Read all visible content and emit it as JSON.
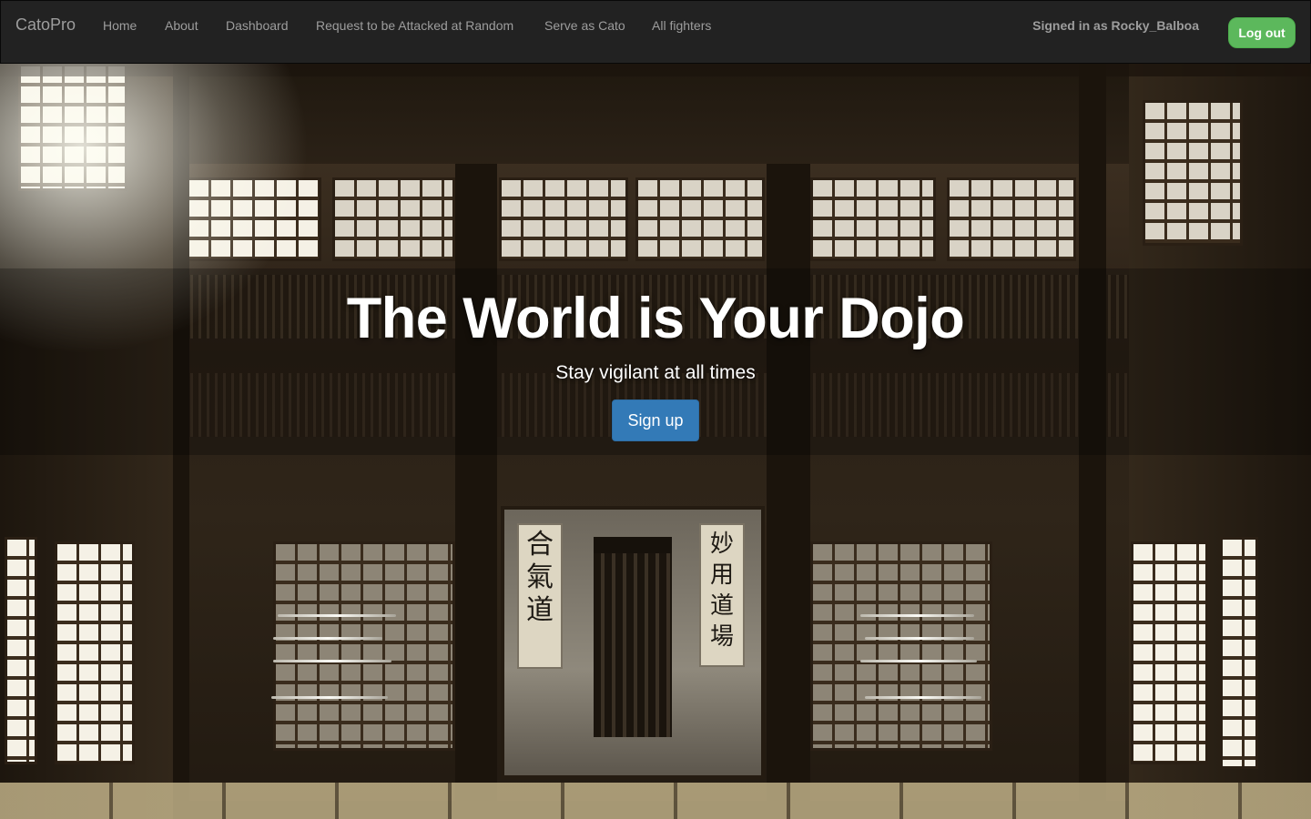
{
  "nav": {
    "brand": "CatoPro",
    "items": [
      {
        "label": "Home"
      },
      {
        "label": "About"
      },
      {
        "label": "Dashboard"
      },
      {
        "label": "Request to be Attacked at Random"
      },
      {
        "label": "Serve as Cato"
      },
      {
        "label": "All fighters"
      }
    ],
    "signed_in_text": "Signed in as Rocky_Balboa",
    "logout_label": "Log out"
  },
  "hero": {
    "title": "The World is Your Dojo",
    "subtitle": "Stay vigilant at all times",
    "signup_label": "Sign up"
  },
  "scene": {
    "scroll_left": "合氣道",
    "scroll_right": "妙用道場"
  },
  "colors": {
    "navbar_bg": "#222222",
    "nav_text": "#9d9d9d",
    "logout_green": "#5cb85c",
    "signup_blue": "#337ab7"
  }
}
